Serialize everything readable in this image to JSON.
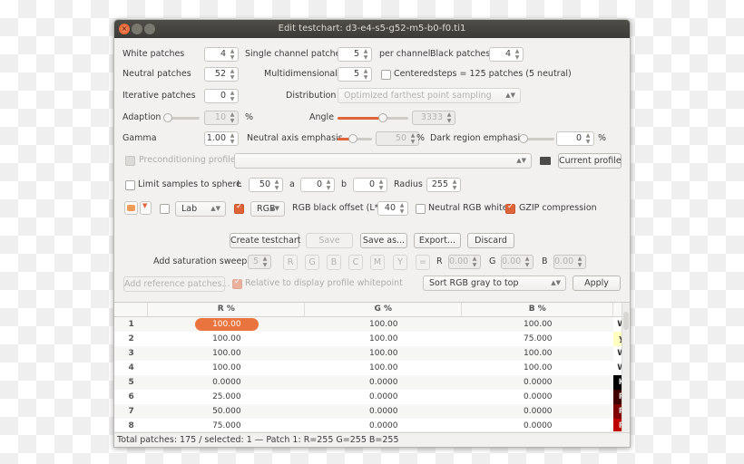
{
  "window": {
    "title": "Edit testchart: d3-e4-s5-g52-m5-b0-f0.ti1"
  },
  "fields": {
    "white_patches": {
      "label": "White patches",
      "value": "4"
    },
    "single_channel": {
      "label": "Single channel patches",
      "value": "5",
      "suffix": "per channel"
    },
    "black_patches": {
      "label": "Black patches",
      "value": "4"
    },
    "neutral_patches": {
      "label": "Neutral patches",
      "value": "52"
    },
    "multidimensional": {
      "label": "Multidimensional",
      "value": "5",
      "centered_label": "Centered",
      "centered_checked": false,
      "info": "steps = 125 patches (5 neutral)"
    },
    "iterative_patches": {
      "label": "Iterative patches",
      "value": "0"
    },
    "distribution": {
      "label": "Distribution",
      "value": "Optimized farthest point sampling"
    },
    "adaption": {
      "label": "Adaption",
      "value": "10",
      "unit": "%",
      "slider_percent": 0
    },
    "angle": {
      "label": "Angle",
      "value": "3333",
      "slider_percent": 0.65
    },
    "gamma": {
      "label": "Gamma",
      "value": "1.00"
    },
    "neutral_axis": {
      "label": "Neutral axis emphasis",
      "value": "50",
      "unit": "%",
      "slider_percent": 0.5
    },
    "dark_region": {
      "label": "Dark region emphasis",
      "value": "0",
      "unit": "%",
      "slider_percent": 0
    },
    "precond": {
      "label": "Preconditioning profile",
      "value": "",
      "current_profile_label": "Current profile"
    },
    "sphere": {
      "label": "Limit samples to sphere",
      "checked": false,
      "L_label": "L",
      "L": "50",
      "a_label": "a",
      "a": "0",
      "b_label": "b",
      "b": "0",
      "radius_label": "Radius",
      "radius": "255"
    },
    "colorspace": {
      "lab_checked": false,
      "lab": "Lab",
      "rgb_checked": true,
      "rgb": "RGB",
      "black_offset_label": "RGB black offset (L*)",
      "black_offset": "40",
      "neutral_white_label": "Neutral RGB white",
      "neutral_white_checked": false,
      "gzip_label": "GZIP compression",
      "gzip_checked": true
    }
  },
  "actions": {
    "create": "Create testchart",
    "save": "Save",
    "save_as": "Save as...",
    "export": "Export...",
    "discard": "Discard"
  },
  "sweeps": {
    "label": "Add saturation sweeps",
    "value": "5",
    "buttons": [
      "R",
      "G",
      "B",
      "C",
      "M",
      "Y",
      "="
    ],
    "R_label": "R",
    "R": "0.00",
    "G_label": "G",
    "G": "0.00",
    "B_label": "B",
    "B": "0.00"
  },
  "reference": {
    "add_label": "Add reference patches...",
    "relative_label": "Relative to display profile whitepoint",
    "relative_checked": true,
    "sort": "Sort RGB gray to top",
    "apply": "Apply"
  },
  "table": {
    "headers": [
      "",
      "R %",
      "G %",
      "B %",
      ""
    ],
    "rows": [
      {
        "n": "1",
        "r": "100.00",
        "g": "100.00",
        "b": "100.00",
        "swatch": "W",
        "color": "#ffffff",
        "text": "#333333"
      },
      {
        "n": "2",
        "r": "100.00",
        "g": "100.00",
        "b": "75.000",
        "swatch": "y",
        "color": "#ffffbf",
        "text": "#333333"
      },
      {
        "n": "3",
        "r": "100.00",
        "g": "100.00",
        "b": "100.00",
        "swatch": "W",
        "color": "#ffffff",
        "text": "#333333"
      },
      {
        "n": "4",
        "r": "100.00",
        "g": "100.00",
        "b": "100.00",
        "swatch": "W",
        "color": "#ffffff",
        "text": "#333333"
      },
      {
        "n": "5",
        "r": "0.0000",
        "g": "0.0000",
        "b": "0.0000",
        "swatch": "K",
        "color": "#000000",
        "text": "#dddddd"
      },
      {
        "n": "6",
        "r": "25.000",
        "g": "0.0000",
        "b": "0.0000",
        "swatch": "R",
        "color": "#400000",
        "text": "#dddddd"
      },
      {
        "n": "7",
        "r": "50.000",
        "g": "0.0000",
        "b": "0.0000",
        "swatch": "R",
        "color": "#800000",
        "text": "#dddddd"
      },
      {
        "n": "8",
        "r": "75.000",
        "g": "0.0000",
        "b": "0.0000",
        "swatch": "R",
        "color": "#bf0000",
        "text": "#dddddd"
      }
    ]
  },
  "status": "Total patches: 175 / selected: 1 — Patch 1: R=255 G=255 B=255",
  "accent": "#e0643a"
}
